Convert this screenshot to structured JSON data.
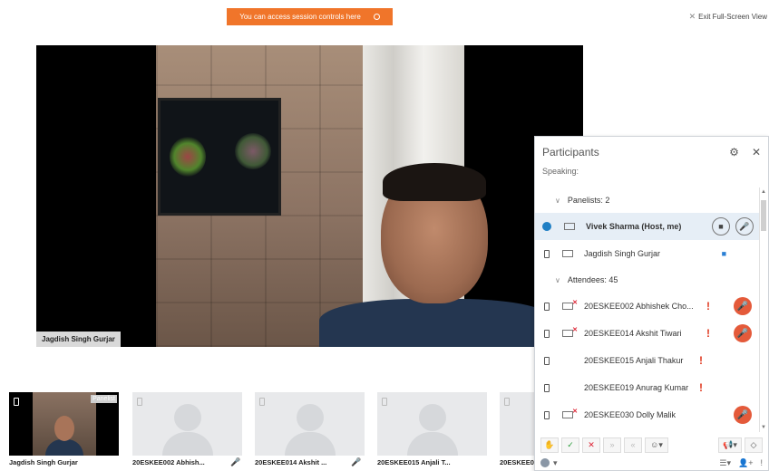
{
  "banner": {
    "text": "You can access session controls here"
  },
  "header": {
    "exit_fullscreen": "Exit Full-Screen View"
  },
  "main_video": {
    "speaker_name": "Jagdish Singh Gurjar"
  },
  "filmstrip": {
    "items": [
      {
        "name": "Jagdish Singh Gurjar",
        "tag": "Panelist",
        "active": true
      },
      {
        "name": "20ESKEE002 Abhish...",
        "muted": true
      },
      {
        "name": "20ESKEE014 Akshit ...",
        "muted": true
      },
      {
        "name": "20ESKEE015 Anjali T..."
      },
      {
        "name": "20ESKEE0"
      }
    ]
  },
  "participants": {
    "title": "Participants",
    "speaking_label": "Speaking:",
    "panelists_label": "Panelists: 2",
    "attendees_label": "Attendees: 45",
    "panelists": [
      {
        "name": "Vivek Sharma (Host, me)"
      },
      {
        "name": "Jagdish Singh Gurjar"
      }
    ],
    "attendees": [
      {
        "name": "20ESKEE002 Abhishek Cho..."
      },
      {
        "name": "20ESKEE014 Akshit Tiwari"
      },
      {
        "name": "20ESKEE015 Anjali Thakur"
      },
      {
        "name": "20ESKEE019 Anurag Kumar"
      },
      {
        "name": "20ESKEE030 Dolly Malik"
      }
    ]
  },
  "colors": {
    "accent": "#f0752a",
    "muted_mic": "#e45a3a",
    "alert": "#e03b22",
    "host_globe": "#1f7fc4"
  }
}
